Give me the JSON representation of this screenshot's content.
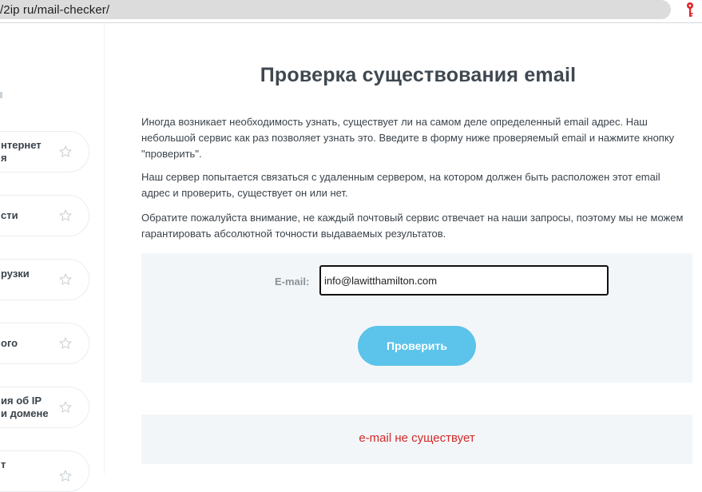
{
  "browser": {
    "url": "/2ip ru/mail-checker/",
    "key_icon": "key-icon",
    "key_color": "#e0242a"
  },
  "sidebar": {
    "items": [
      {
        "label": "нтернет\nя",
        "icon": "star-icon"
      },
      {
        "label": "сти",
        "icon": "star-icon"
      },
      {
        "label": "рузки",
        "icon": "star-icon"
      },
      {
        "label": "ого",
        "icon": "star-icon"
      },
      {
        "label": "ия об IP\nи домене",
        "icon": "star-icon"
      },
      {
        "label": "т",
        "icon": "star-icon"
      }
    ]
  },
  "main": {
    "title": "Проверка существования email",
    "paragraphs": [
      "Иногда возникает необходимость узнать, существует ли на самом деле определенный email адрес. Наш небольшой сервис как раз позволяет узнать это. Введите в форму ниже проверяемый email и нажмите кнопку \"проверить\".",
      "Наш сервер попытается связаться с удаленным сервером, на котором должен быть расположен этот email адрес и проверить, существует он или нет.",
      "Обратите пожалуйста внимание, не каждый почтовый сервис отвечает на наши запросы, поэтому мы не можем гарантировать абсолютной точности выдаваемых результатов."
    ],
    "form": {
      "email_label": "E-mail:",
      "email_value": "info@lawitthamilton.com",
      "submit_label": "Проверить"
    },
    "result": {
      "text": "e-mail не существует",
      "color": "#d12a2a"
    }
  },
  "colors": {
    "accent_button": "#5cc3ea",
    "panel_background": "#f3f6f8",
    "heading": "#3f4850"
  }
}
